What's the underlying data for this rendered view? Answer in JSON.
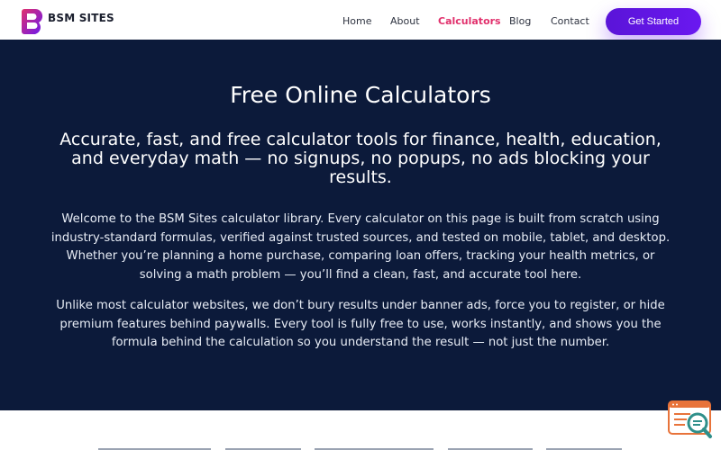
{
  "brand": {
    "name": "BSM SITES"
  },
  "nav": {
    "items": [
      {
        "label": "Home"
      },
      {
        "label": "About"
      },
      {
        "label": "Calculators"
      },
      {
        "label": "Blog"
      },
      {
        "label": "Contact"
      }
    ],
    "active": "Calculators",
    "cta_label": "Get Started"
  },
  "hero": {
    "title": "Free Online Calculators",
    "subtitle": "Accurate, fast, and free calculator tools for finance, health, education, and everyday math — no signups, no popups, no ads blocking your results.",
    "paragraphs": [
      "Welcome to the BSM Sites calculator library. Every calculator on this page is built from scratch using industry-standard formulas, verified against trusted sources, and tested on mobile, tablet, and desktop. Whether you’re planning a home purchase, comparing loan offers, tracking your health metrics, or solving a math problem — you’ll find a clean, fast, and accurate tool here.",
      "Unlike most calculator websites, we don’t bury results under banner ads, force you to register, or hide premium features behind paywalls. Every tool is fully free to use, works instantly, and shows you the formula behind the calculation so you understand the result — not just the number."
    ]
  },
  "icons": {
    "logo": "bsm-logo-icon",
    "help": "search-chat-icon"
  },
  "colors": {
    "hero_background": "#0c1a3a",
    "accent_active": "#e1306c",
    "cta_background": "#5a14d8",
    "logo_gradient_start": "#e1306c",
    "logo_gradient_end": "#6a18f0",
    "widget_orange": "#e8733a",
    "widget_teal": "#2f8f8a"
  }
}
